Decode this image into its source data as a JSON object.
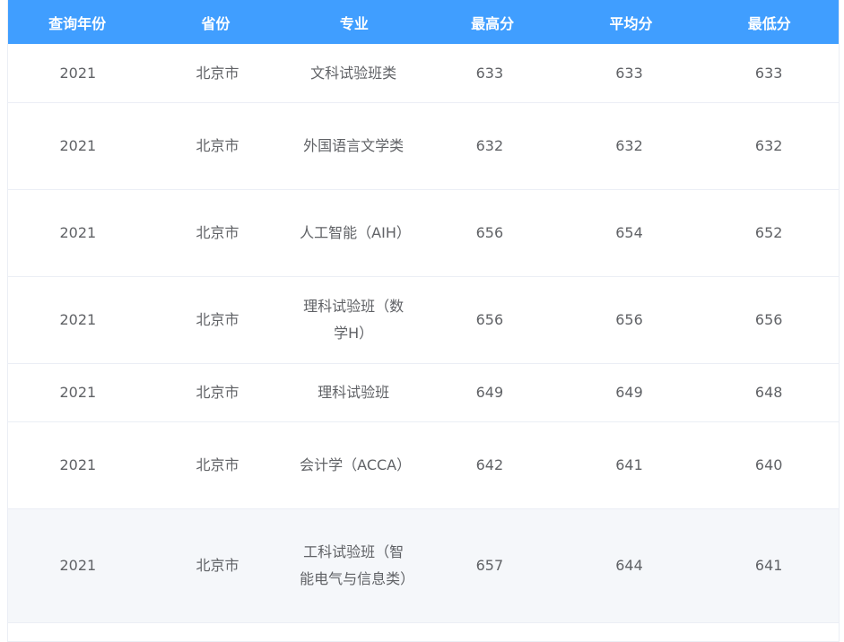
{
  "header": {
    "year": "查询年份",
    "province": "省份",
    "major": "专业",
    "max": "最高分",
    "avg": "平均分",
    "min": "最低分"
  },
  "colors": {
    "header_bg": "#409eff",
    "header_text": "#ffffff",
    "cell_text": "#606266",
    "border": "#ebeef5",
    "hover_row_bg": "#f5f7fa"
  },
  "rows": [
    {
      "year": "2021",
      "province": "北京市",
      "major": "文科试验班类",
      "max": "633",
      "avg": "633",
      "min": "633"
    },
    {
      "year": "2021",
      "province": "北京市",
      "major": "外国语言文学类",
      "max": "632",
      "avg": "632",
      "min": "632"
    },
    {
      "year": "2021",
      "province": "北京市",
      "major": "人工智能（AIH）",
      "max": "656",
      "avg": "654",
      "min": "652"
    },
    {
      "year": "2021",
      "province": "北京市",
      "major": "理科试验班（数学H）",
      "max": "656",
      "avg": "656",
      "min": "656"
    },
    {
      "year": "2021",
      "province": "北京市",
      "major": "理科试验班",
      "max": "649",
      "avg": "649",
      "min": "648"
    },
    {
      "year": "2021",
      "province": "北京市",
      "major": "会计学（ACCA）",
      "max": "642",
      "avg": "641",
      "min": "640"
    },
    {
      "year": "2021",
      "province": "北京市",
      "major": "工科试验班（智能电气与信息类）",
      "max": "657",
      "avg": "644",
      "min": "641"
    }
  ]
}
